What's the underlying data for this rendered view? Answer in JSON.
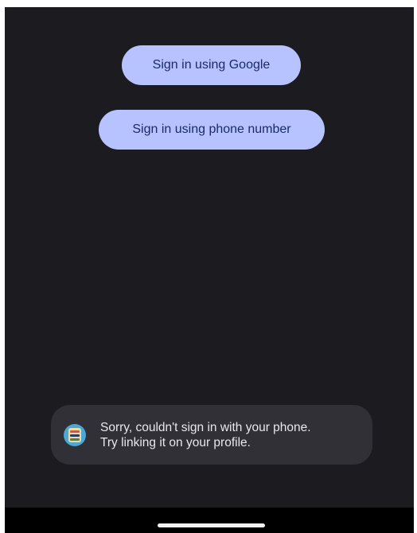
{
  "buttons": {
    "google_label": "Sign in using Google",
    "phone_label": "Sign in using phone number"
  },
  "toast": {
    "icon": "app-icon",
    "line1": "Sorry, couldn't sign in with your phone.",
    "line2": "Try linking it on your profile."
  },
  "colors": {
    "background": "#1c1b20",
    "button_bg": "#b6c3ff",
    "button_text": "#1b2a6b",
    "toast_bg": "#303036"
  }
}
